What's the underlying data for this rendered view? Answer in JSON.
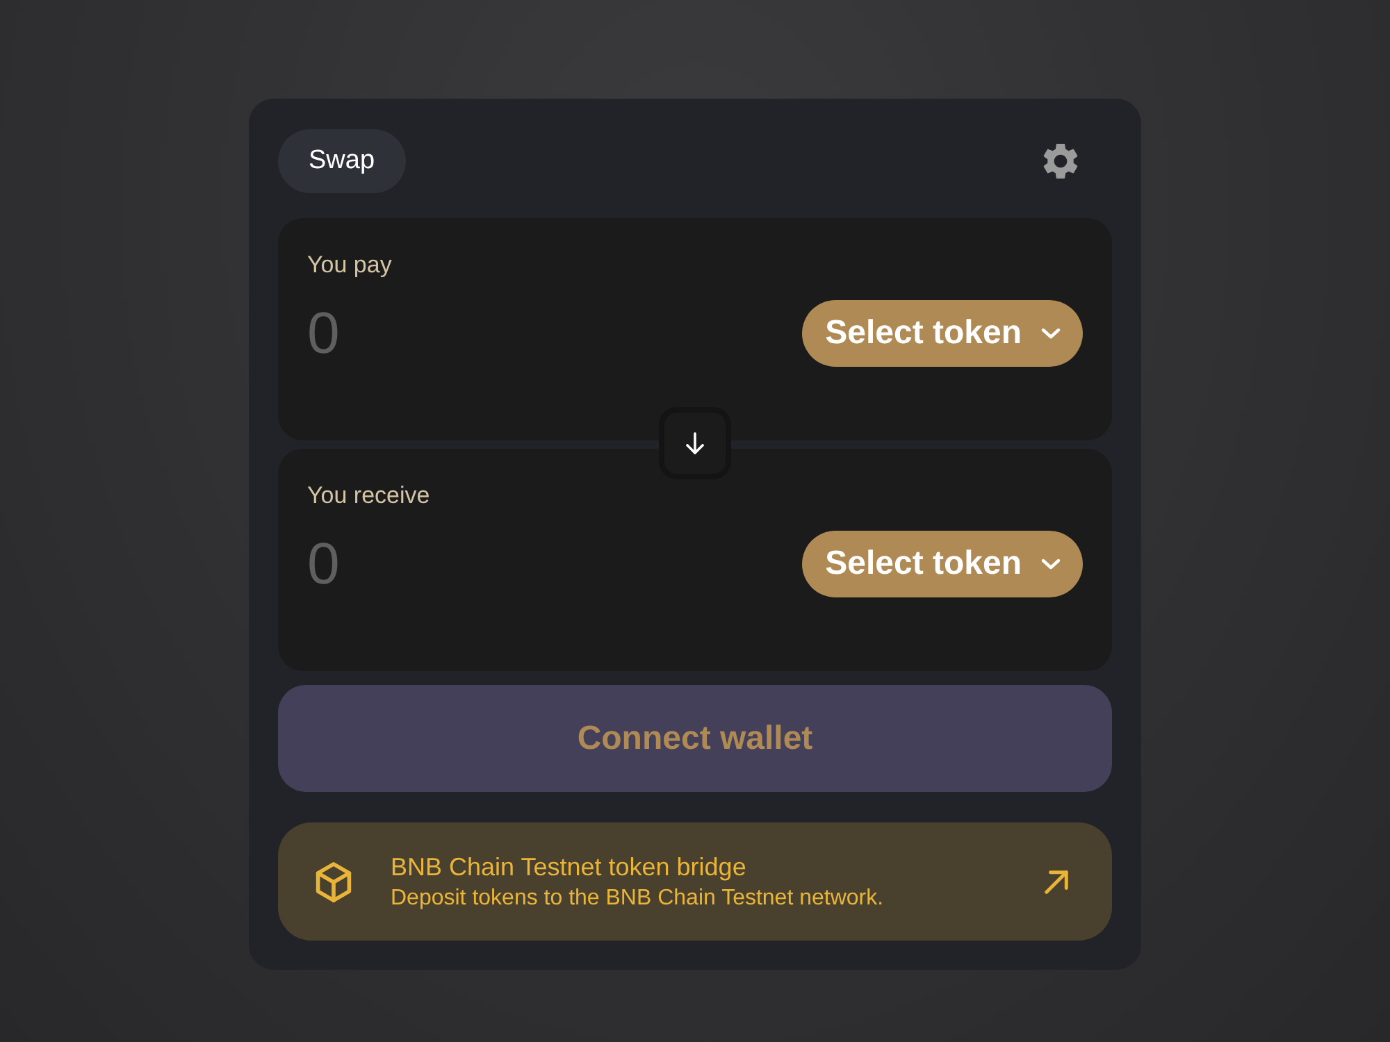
{
  "header": {
    "tabs": [
      {
        "label": "Swap",
        "selected": true
      }
    ]
  },
  "panels": [
    {
      "label": "You pay",
      "placeholder": "0",
      "token_button": "Select token"
    },
    {
      "label": "You receive",
      "placeholder": "0",
      "token_button": "Select token"
    }
  ],
  "connect_button": {
    "label": "Connect wallet"
  },
  "bridge_banner": {
    "title": "BNB Chain Testnet token bridge",
    "description": "Deposit tokens to the BNB Chain Testnet network."
  }
}
